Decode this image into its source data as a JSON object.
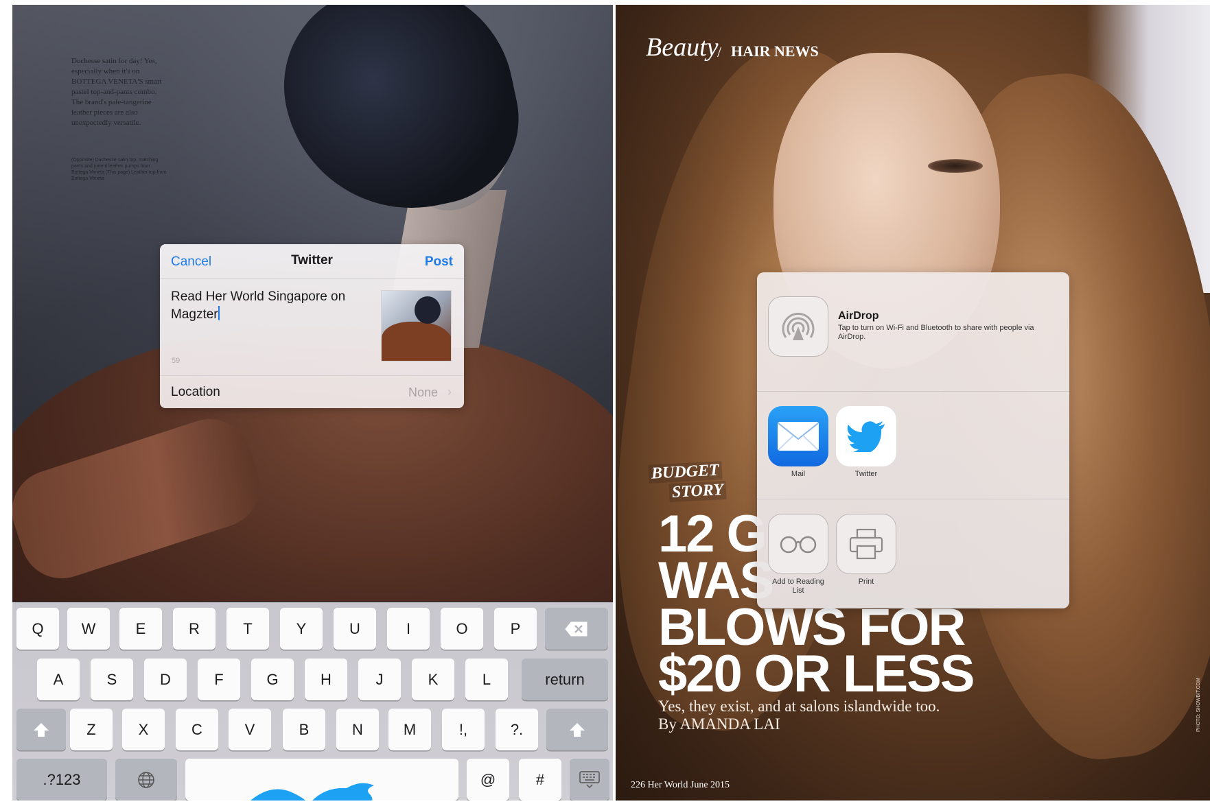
{
  "left": {
    "magazine_text": "Duchesse satin for day! Yes, especially when it's on BOTTEGA VENETA'S smart pastel top-and-pants combo. The brand's pale-tangerine leather pieces are also unexpectedly versatile.",
    "magazine_caption": "(Opposite) Duchesse satin top, matching pants and patent leather pumps from Bottega Veneta (This page) Leather top from Bottega Veneta",
    "twitter_sheet": {
      "cancel_label": "Cancel",
      "title": "Twitter",
      "post_label": "Post",
      "message_line1": "Read Her World Singapore on",
      "message_line2": "Magzter",
      "char_count": "59",
      "location_label": "Location",
      "location_value": "None",
      "location_chevron": "›"
    },
    "keyboard": {
      "row1": [
        "Q",
        "W",
        "E",
        "R",
        "T",
        "Y",
        "U",
        "I",
        "O",
        "P"
      ],
      "row2": [
        "A",
        "S",
        "D",
        "F",
        "G",
        "H",
        "J",
        "K",
        "L"
      ],
      "row3": [
        "Z",
        "X",
        "C",
        "V",
        "B",
        "N",
        "M",
        "!,",
        "?."
      ],
      "row4_numbers": ".?123",
      "row4_at": "@",
      "row4_hash": "#",
      "return_label": "return",
      "icons": {
        "backspace": "backspace-icon",
        "shift": "shift-icon",
        "globe": "globe-icon",
        "dismiss": "keyboard-dismiss-icon"
      }
    }
  },
  "right": {
    "section_beauty": "Beauty",
    "section_slash": "/",
    "section_hair_news": "HAIR NEWS",
    "budget_line1": "BUDGET",
    "budget_line2": "STORY",
    "headline_1": "12 G",
    "headline_2": "WAS",
    "headline_3": "BLOWS FOR",
    "headline_4": "$20 OR LESS",
    "subhead": "Yes, they exist, and at salons islandwide too.",
    "byline": "By AMANDA LAI",
    "folio": "226  Her World  June  2015",
    "photo_credit": "PHOTO: SHOWBIT.COM",
    "share_sheet": {
      "airdrop_title": "AirDrop",
      "airdrop_desc": "Tap to turn on Wi-Fi and Bluetooth to share with people via AirDrop.",
      "apps": [
        {
          "label": "Mail",
          "icon": "mail-icon"
        },
        {
          "label": "Twitter",
          "icon": "twitter-bird-icon"
        }
      ],
      "actions": [
        {
          "label": "Add to Reading List",
          "icon": "reading-glasses-icon"
        },
        {
          "label": "Print",
          "icon": "printer-icon"
        }
      ]
    }
  },
  "colors": {
    "ios_blue": "#1f7ce6",
    "twitter_blue": "#1da1f2",
    "mail_blue": "#1a7ff0"
  }
}
